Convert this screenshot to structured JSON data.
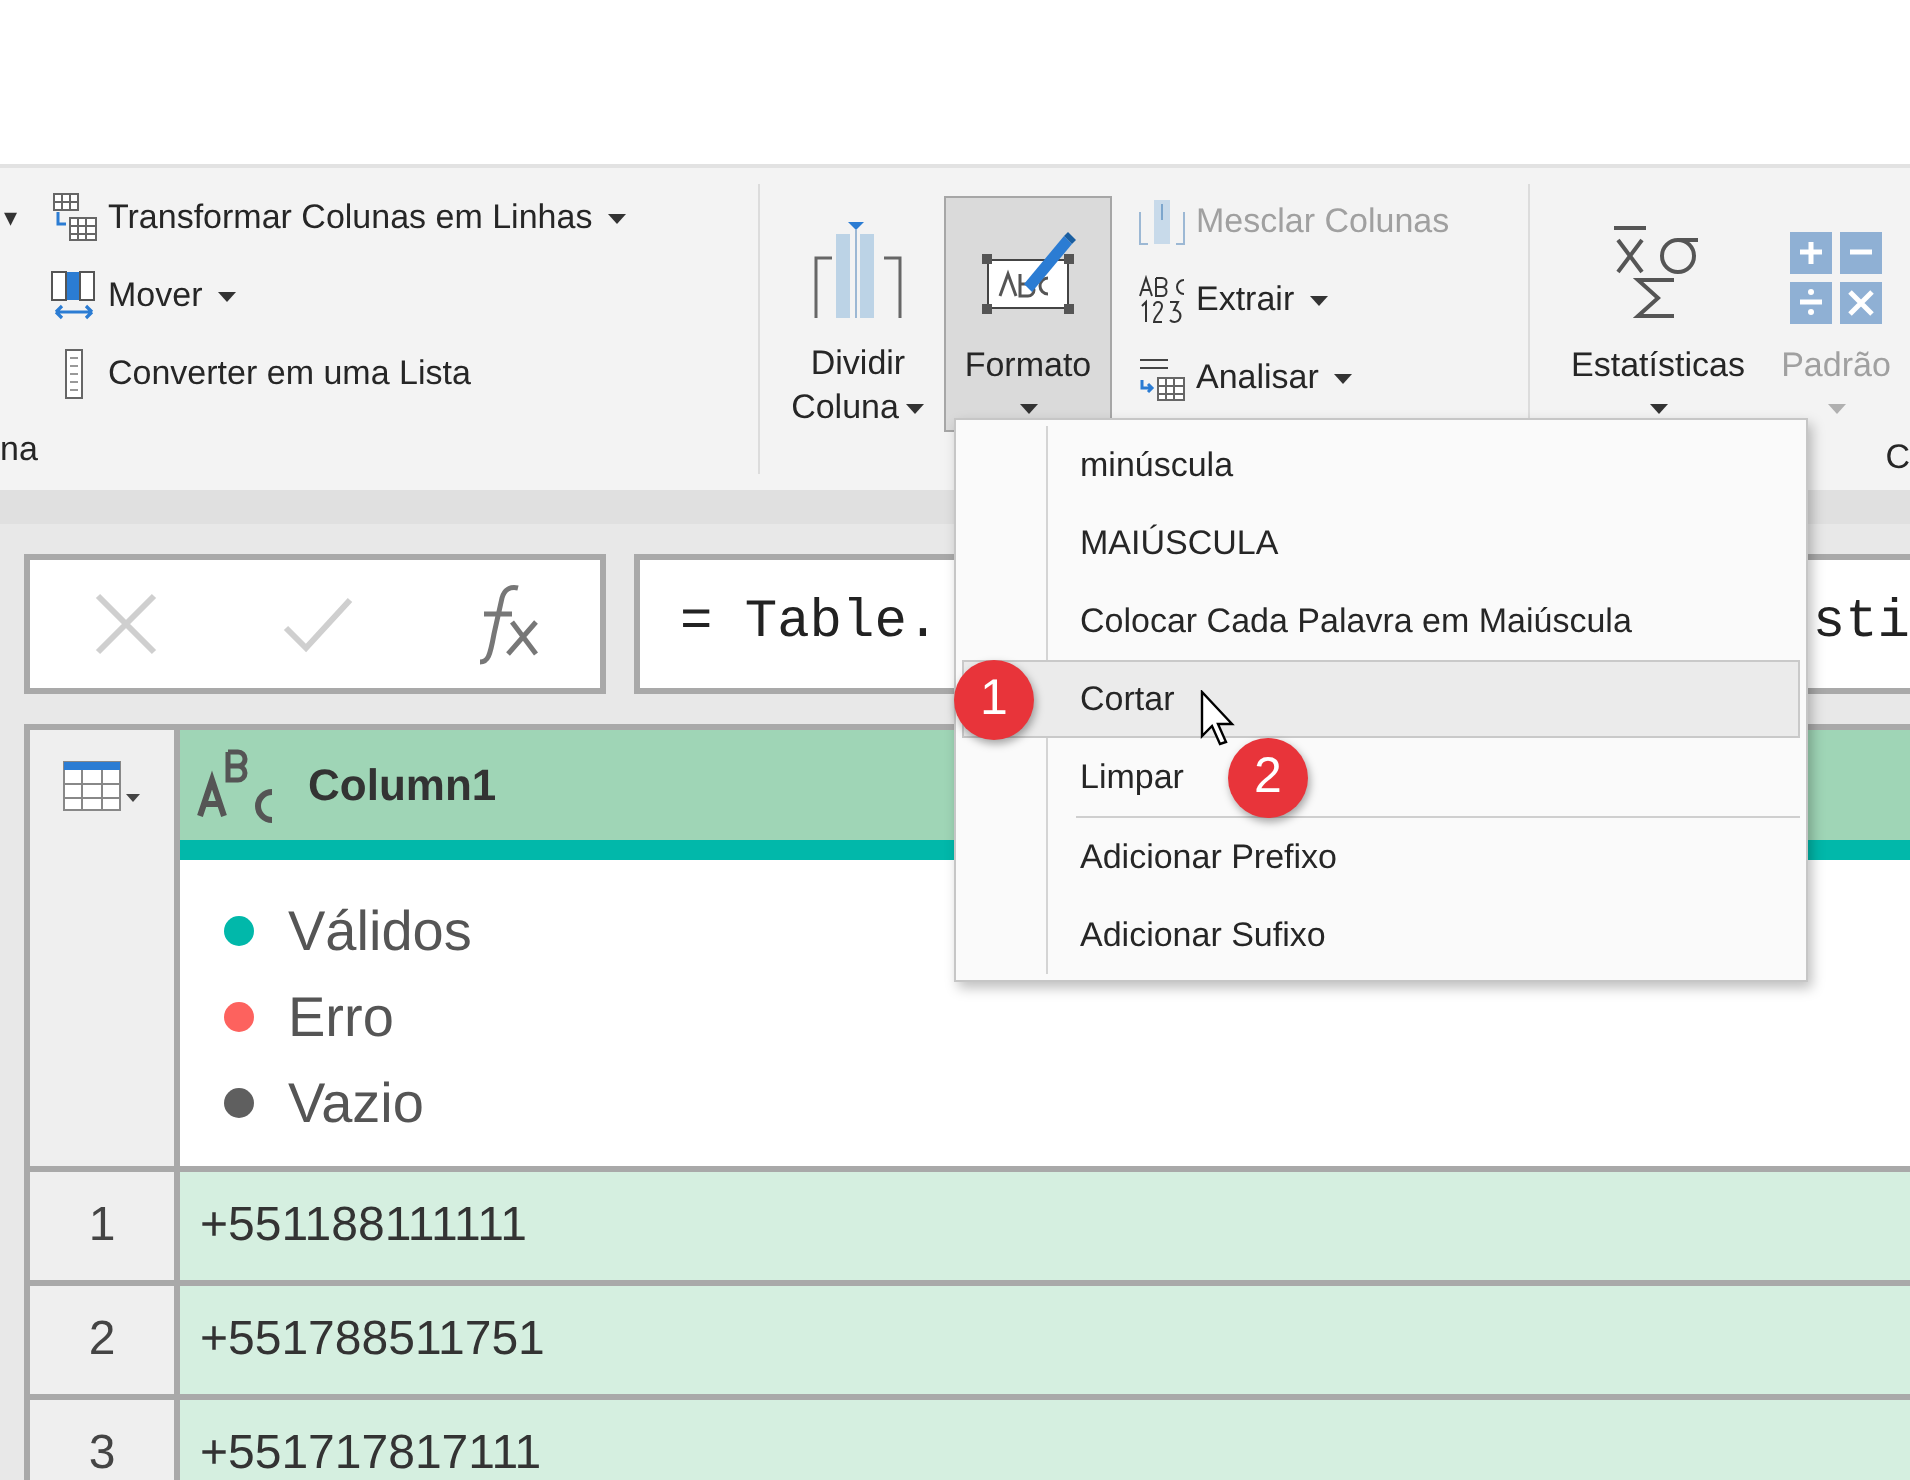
{
  "ribbon": {
    "left_caret": "▾",
    "column_group": {
      "label": "na",
      "items": [
        {
          "kind": "unpivot",
          "label": "Transformar Colunas em Linhas",
          "dropdown": true,
          "disabled": false
        },
        {
          "kind": "move",
          "label": "Mover",
          "dropdown": true,
          "disabled": false
        },
        {
          "kind": "list",
          "label": "Converter em uma Lista",
          "dropdown": false,
          "disabled": false
        }
      ]
    },
    "text_group": {
      "large_buttons": [
        {
          "kind": "split",
          "lines": [
            "Dividir",
            "Coluna"
          ],
          "selected": false,
          "disabled": false
        },
        {
          "kind": "format",
          "lines": [
            "Formato"
          ],
          "selected": true,
          "disabled": false
        }
      ],
      "items": [
        {
          "kind": "merge",
          "label": "Mesclar Colunas",
          "dropdown": false,
          "disabled": true
        },
        {
          "kind": "extract",
          "label": "Extrair",
          "dropdown": true,
          "disabled": false
        },
        {
          "kind": "parse",
          "label": "Analisar",
          "dropdown": true,
          "disabled": false
        }
      ]
    },
    "number_group": {
      "label": "C",
      "large_buttons": [
        {
          "kind": "stats",
          "lines": [
            "Estatísticas"
          ],
          "selected": false,
          "disabled": false
        },
        {
          "kind": "standard",
          "lines": [
            "Padrão"
          ],
          "selected": false,
          "disabled": true
        }
      ]
    }
  },
  "formula_bar": {
    "text": "= Table.",
    "text_end": "sti"
  },
  "table": {
    "column": "Column1",
    "quality": [
      {
        "label": "Válidos",
        "color": "#01b8aa"
      },
      {
        "label": "Erro",
        "color": "#fd625e"
      },
      {
        "label": "Vazio",
        "color": "#5f5f5f"
      }
    ],
    "rows": [
      {
        "number": "1",
        "value": "+551188111111"
      },
      {
        "number": "2",
        "value": "+551788511751"
      },
      {
        "number": "3",
        "value": "+551717817111"
      }
    ]
  },
  "menu": {
    "groups": [
      {
        "items": [
          {
            "label": "minúscula",
            "selected": false
          },
          {
            "label": "MAIÚSCULA",
            "selected": false
          },
          {
            "label": "Colocar Cada Palavra em Maiúscula",
            "selected": false
          },
          {
            "label": "Cortar",
            "selected": true
          },
          {
            "label": "Limpar",
            "selected": false
          }
        ]
      },
      {
        "items": [
          {
            "label": "Adicionar Prefixo",
            "selected": false
          },
          {
            "label": "Adicionar Sufixo",
            "selected": false
          }
        ]
      }
    ]
  },
  "badges": [
    {
      "text": "1"
    },
    {
      "text": "2"
    }
  ]
}
